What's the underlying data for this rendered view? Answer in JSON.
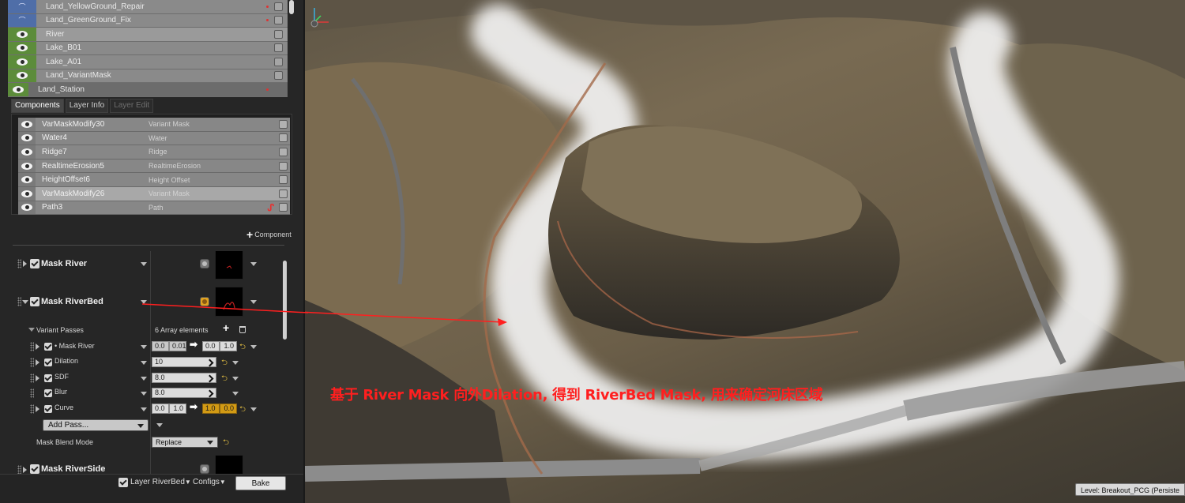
{
  "layers": [
    {
      "name": "Land_YellowGround_Repair",
      "strip": "blue",
      "flag": true
    },
    {
      "name": "Land_GreenGround_Fix",
      "strip": "blue",
      "flag": true
    },
    {
      "name": "River",
      "strip": "green",
      "flag": false
    },
    {
      "name": "Lake_B01",
      "strip": "green",
      "flag": false
    },
    {
      "name": "Lake_A01",
      "strip": "green",
      "flag": false
    },
    {
      "name": "Land_VariantMask",
      "strip": "green",
      "flag": false
    },
    {
      "name": "Land_Station",
      "strip": "green",
      "flag": true
    }
  ],
  "tabs": [
    "Components",
    "Layer Info",
    "Layer Edit"
  ],
  "components": [
    {
      "name": "VarMaskModify30",
      "type": "Variant Mask"
    },
    {
      "name": "Water4",
      "type": "Water"
    },
    {
      "name": "Ridge7",
      "type": "Ridge"
    },
    {
      "name": "RealtimeErosion5",
      "type": "RealtimeErosion"
    },
    {
      "name": "HeightOffset6",
      "type": "Height Offset"
    },
    {
      "name": "VarMaskModify26",
      "type": "Variant Mask"
    },
    {
      "name": "Path3",
      "type": "Path"
    }
  ],
  "add_component_label": "Component",
  "masks": {
    "river": "Mask River",
    "riverbed": "Mask RiverBed",
    "riverside": "Mask RiverSide"
  },
  "variant_passes": {
    "label": "Variant Passes",
    "count_label": "6 Array elements",
    "passes": [
      {
        "name": "• Mask River",
        "in_min": "0.0",
        "in_max": "0.01",
        "out_min": "0.0",
        "out_max": "1.0"
      },
      {
        "name": "Dilation",
        "value": "10"
      },
      {
        "name": "SDF",
        "value": "8.0"
      },
      {
        "name": "Blur",
        "value": "8.0"
      },
      {
        "name": "Curve",
        "in_min": "0.0",
        "in_max": "1.0",
        "out_min": "1.0",
        "out_max": "0.0"
      }
    ],
    "add_pass_label": "Add Pass...",
    "blend_mode_label": "Mask Blend Mode",
    "blend_mode_value": "Replace"
  },
  "footer": {
    "layer_label": "Layer RiverBed",
    "configs_label": "Configs",
    "bake_label": "Bake"
  },
  "viewport": {
    "annotation": "基于 River Mask 向外Dilation, 得到 RiverBed Mask, 用来确定河床区域",
    "level_label": "Level:  Breakout_PCG (Persiste"
  },
  "colors": {
    "annotation": "#ff1f1f",
    "mask_white": "#f2f2f2",
    "terrain": "#786a52",
    "layer_green": "#5c8c3a",
    "layer_blue": "#4f6ea8"
  }
}
